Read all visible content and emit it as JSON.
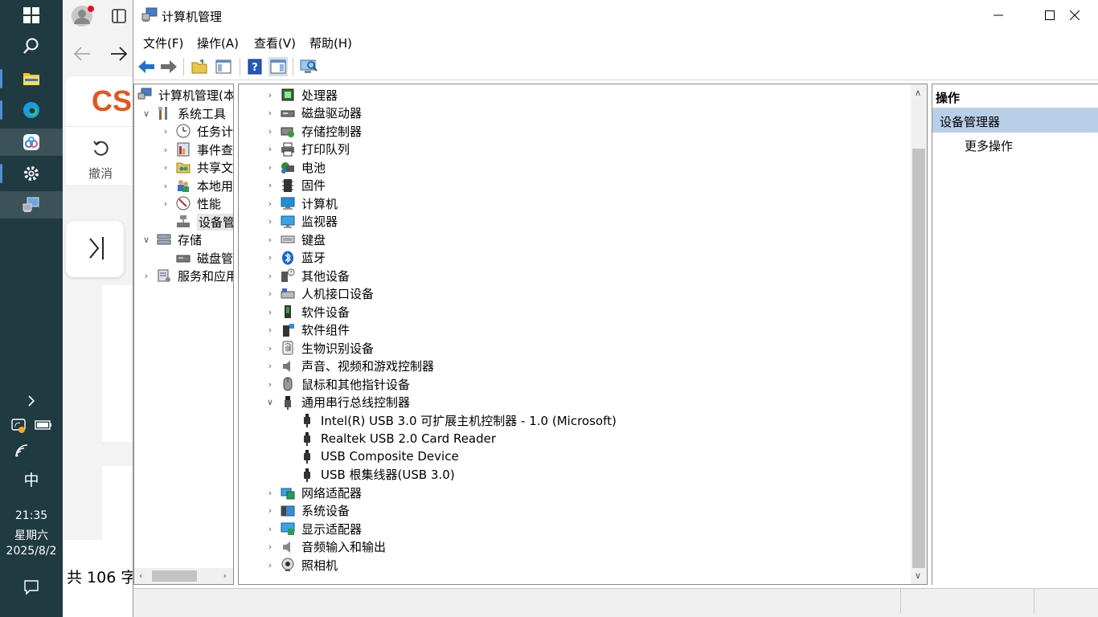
{
  "taskbar": {
    "input_method": "中",
    "time": "21:35",
    "weekday": "星期六",
    "date": "2025/8/2"
  },
  "browser": {
    "logo_text": "CS",
    "undo_label": "撤消",
    "word_count": "共 106 字"
  },
  "window": {
    "title": "计算机管理",
    "menus": [
      "文件(F)",
      "操作(A)",
      "查看(V)",
      "帮助(H)"
    ]
  },
  "tree": {
    "root": "计算机管理(本",
    "items": [
      {
        "label": "系统工具"
      },
      {
        "label": "任务计"
      },
      {
        "label": "事件查"
      },
      {
        "label": "共享文"
      },
      {
        "label": "本地用"
      },
      {
        "label": "性能"
      },
      {
        "label": "设备管"
      },
      {
        "label": "存储"
      },
      {
        "label": "磁盘管"
      },
      {
        "label": "服务和应用"
      }
    ]
  },
  "devices": {
    "categories": [
      {
        "label": "处理器",
        "icon": "cpu-icon"
      },
      {
        "label": "磁盘驱动器",
        "icon": "disk-drive-icon"
      },
      {
        "label": "存储控制器",
        "icon": "storage-controller-icon"
      },
      {
        "label": "打印队列",
        "icon": "printer-icon"
      },
      {
        "label": "电池",
        "icon": "battery-icon"
      },
      {
        "label": "固件",
        "icon": "firmware-icon"
      },
      {
        "label": "计算机",
        "icon": "computer-icon"
      },
      {
        "label": "监视器",
        "icon": "monitor-icon"
      },
      {
        "label": "键盘",
        "icon": "keyboard-icon"
      },
      {
        "label": "蓝牙",
        "icon": "bluetooth-icon"
      },
      {
        "label": "其他设备",
        "icon": "other-devices-icon"
      },
      {
        "label": "人机接口设备",
        "icon": "hid-icon"
      },
      {
        "label": "软件设备",
        "icon": "software-device-icon"
      },
      {
        "label": "软件组件",
        "icon": "software-component-icon"
      },
      {
        "label": "生物识别设备",
        "icon": "biometric-icon"
      },
      {
        "label": "声音、视频和游戏控制器",
        "icon": "speaker-icon"
      },
      {
        "label": "鼠标和其他指针设备",
        "icon": "mouse-icon"
      },
      {
        "label": "通用串行总线控制器",
        "icon": "usb-icon",
        "expanded": true
      },
      {
        "label": "网络适配器",
        "icon": "network-adapter-icon"
      },
      {
        "label": "系统设备",
        "icon": "system-device-icon"
      },
      {
        "label": "显示适配器",
        "icon": "display-adapter-icon"
      },
      {
        "label": "音频输入和输出",
        "icon": "audio-io-icon"
      },
      {
        "label": "照相机",
        "icon": "camera-icon"
      }
    ],
    "usb_children": [
      "Intel(R) USB 3.0 可扩展主机控制器 - 1.0 (Microsoft)",
      "Realtek USB 2.0 Card Reader",
      "USB Composite Device",
      "USB 根集线器(USB 3.0)"
    ]
  },
  "actions": {
    "header": "操作",
    "selected": "设备管理器",
    "more": "更多操作"
  },
  "colors": {
    "taskbar_bg": "#1f3a40",
    "selection_bg": "#b9cfe8",
    "accent_blue": "#1e73c8",
    "logo_orange": "#e8541c"
  }
}
